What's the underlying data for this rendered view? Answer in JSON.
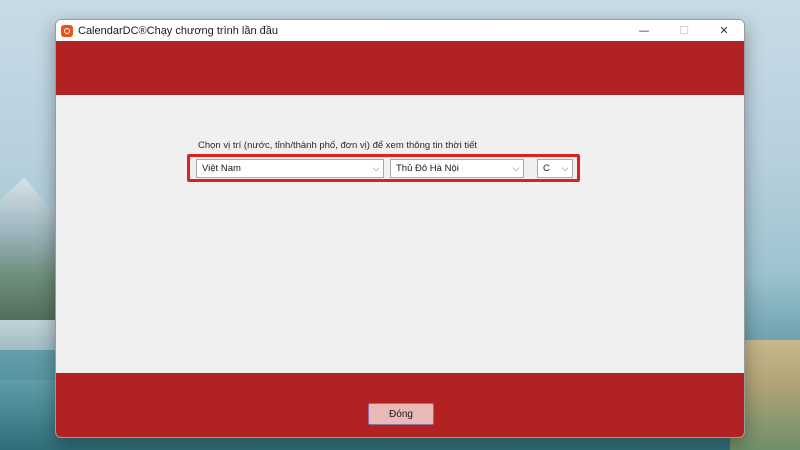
{
  "window": {
    "title": "CalendarDC®Chạy chương trình lần đầu",
    "controls": {
      "minimize": "—",
      "maximize": "☐",
      "close": "✕"
    },
    "accent_color": "#b22222"
  },
  "location": {
    "prompt": "Chọn vị trí (nước, tỉnh/thành phố, đơn vị) để xem thông tin thời tiết",
    "country_value": "Việt Nam",
    "city_value": "Thủ Đô Hà Nội",
    "unit_value": "C",
    "highlight_color": "#e01f1f"
  },
  "footer": {
    "close_label": "Đóng"
  },
  "icons": {
    "app": "calendardc-app-icon",
    "dropdown": "chevron-down-icon"
  }
}
